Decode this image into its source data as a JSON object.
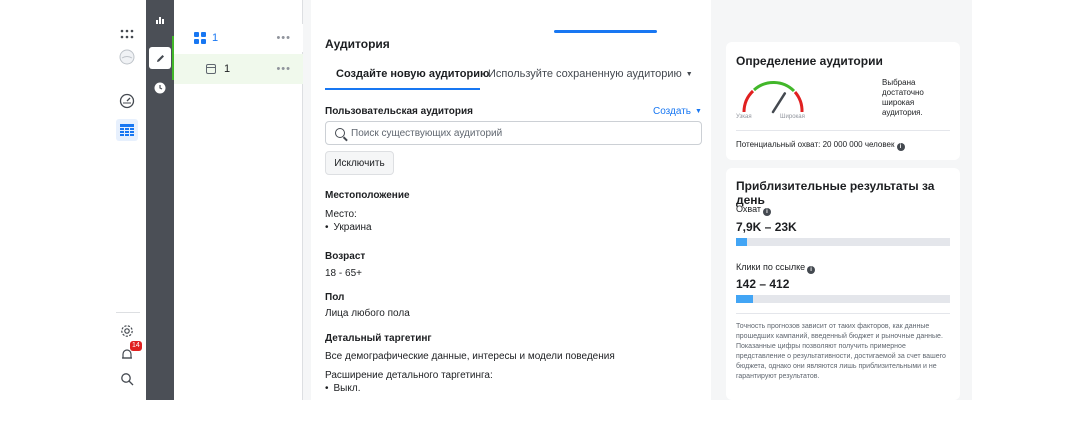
{
  "left_tree": {
    "campaign_label": "1",
    "adset_label": "1",
    "more_label": "•••"
  },
  "notifications_badge": "14",
  "audience": {
    "title": "Аудитория",
    "tabs": [
      {
        "label": "Создайте новую аудиторию",
        "active": true
      },
      {
        "label": "Используйте сохраненную аудиторию",
        "active": false
      }
    ],
    "custom_audience": {
      "label": "Пользовательская аудитория",
      "create_label": "Создать",
      "search_placeholder": "Поиск существующих аудиторий",
      "exclude_label": "Исключить"
    },
    "location": {
      "label": "Местоположение",
      "place_label": "Место:",
      "value": "Украина"
    },
    "age": {
      "label": "Возраст",
      "value": "18 - 65+"
    },
    "gender": {
      "label": "Пол",
      "value": "Лица любого пола"
    },
    "detailed_targeting": {
      "label": "Детальный таргетинг",
      "value": "Все демографические данные, интересы и модели поведения",
      "expansion_label": "Расширение детального таргетинга:",
      "expansion_value": "Выкл."
    }
  },
  "audience_definition": {
    "title": "Определение аудитории",
    "gauge_narrow": "Узкая",
    "gauge_wide": "Широкая",
    "description": "Выбрана достаточно широкая аудитория.",
    "potential_reach": "Потенциальный охват: 20 000 000 человек",
    "gauge_level": 0.68
  },
  "daily_results": {
    "title": "Приблизительные результаты за день",
    "reach_label": "Охват",
    "reach_value": "7,9K – 23K",
    "reach_fill": 0.05,
    "clicks_label": "Клики по ссылке",
    "clicks_value": "142 – 412",
    "clicks_fill": 0.08,
    "disclaimer": "Точность прогнозов зависит от таких факторов, как данные прошедших кампаний, введенный бюджет и рыночные данные. Показанные цифры позволяют получить примерное представление о результативности, достигаемой за счет вашего бюджета, однако они являются лишь приблизительными и не гарантируют результатов."
  },
  "colors": {
    "accent": "#1877f2",
    "bar_fill": "#42a5f5",
    "green": "#42b72a",
    "strip": "#4b4f56",
    "badge": "#e02020"
  }
}
